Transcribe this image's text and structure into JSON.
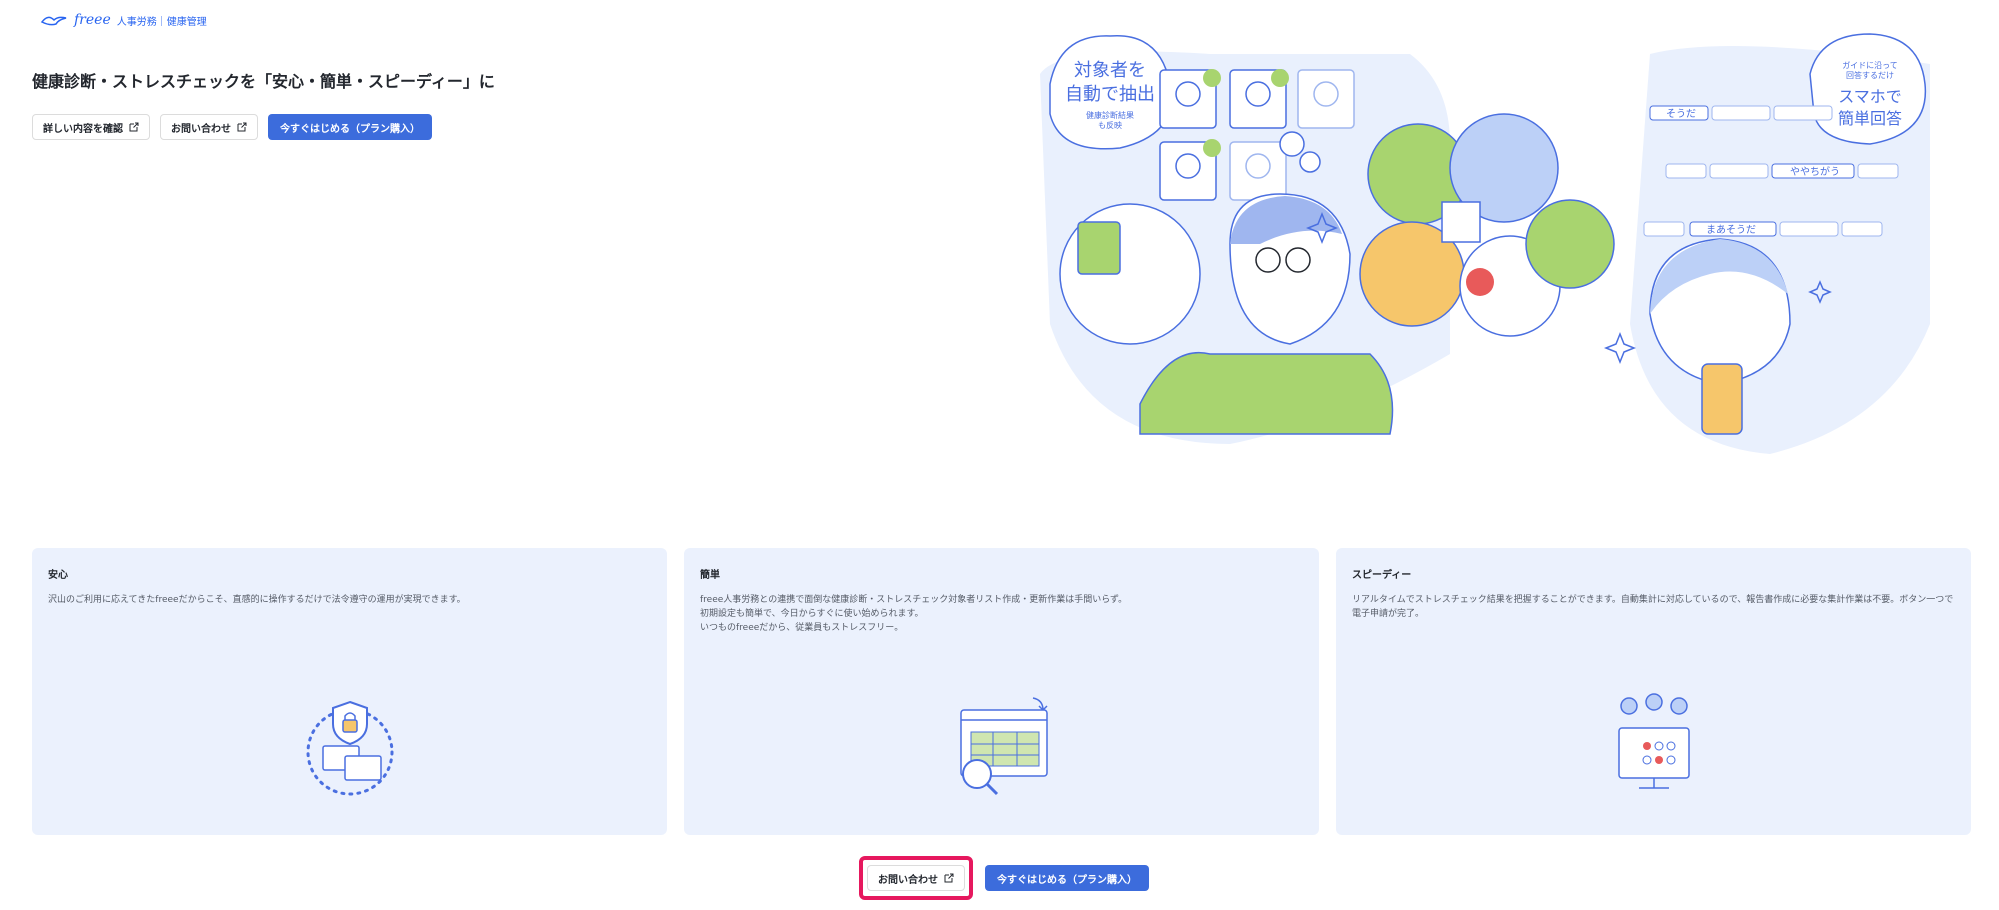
{
  "header": {
    "brand": "freee",
    "product": "人事労務｜健康管理"
  },
  "hero": {
    "headline": "健康診断・ストレスチェックを「安心・簡単・スピーディー」に",
    "buttons": {
      "details": "詳しい内容を確認",
      "contact": "お問い合わせ",
      "start": "今すぐはじめる（プラン購入）"
    },
    "illustration": {
      "bubble_left_main": "対象者を\n自動で抽出",
      "bubble_left_sub": "健康診断結果\nも反映",
      "bubble_right_sub": "ガイドに沿って\n回答するだけ",
      "bubble_right_main": "スマホで\n簡単回答",
      "answer_1": "そうだ",
      "answer_2": "ややちがう",
      "answer_3": "まあそうだ"
    }
  },
  "features": [
    {
      "title": "安心",
      "body": "沢山のご利用に応えてきたfreeeだからこそ、直感的に操作するだけで法令遵守の運用が実現できます。",
      "icon": "lock-shield-icon"
    },
    {
      "title": "簡単",
      "body": "freee人事労務との連携で面倒な健康診断・ストレスチェック対象者リスト作成・更新作業は手間いらず。\n初期設定も簡単で、今日からすぐに使い始められます。\nいつものfreeeだから、従業員もストレスフリー。",
      "icon": "spreadsheet-search-icon"
    },
    {
      "title": "スピーディー",
      "body": "リアルタイムでストレスチェック結果を把握することができます。自動集計に対応しているので、報告書作成に必要な集計作業は不要。ボタン一つで電子申請が完了。",
      "icon": "monitor-people-icon"
    }
  ],
  "footer_actions": {
    "contact": "お問い合わせ",
    "start": "今すぐはじめる（プラン購入）"
  },
  "colors": {
    "primary": "#3c6cdc",
    "card_bg": "#ebf1fd",
    "highlight": "#e6185e",
    "illustration_blue": "#4a6fe0",
    "illustration_green": "#a8d46f",
    "illustration_yellow": "#f6c66b"
  }
}
